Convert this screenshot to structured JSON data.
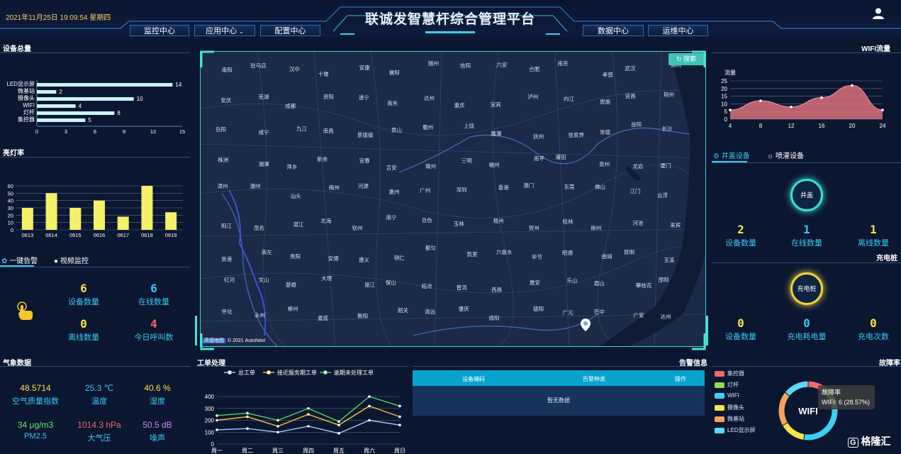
{
  "header": {
    "datetime": "2021年11月25日 19:09:54 星期四",
    "title": "联诚发智慧杆综合管理平台",
    "nav": [
      "监控中心",
      "应用中心",
      "配置中心",
      "数据中心",
      "运维中心"
    ]
  },
  "device_total": {
    "title": "设备总量",
    "chart_data": {
      "type": "bar",
      "orientation": "horizontal",
      "categories": [
        "LED显示屏",
        "微基站",
        "摄像头",
        "WIFI",
        "灯杆",
        "集控器"
      ],
      "values": [
        14,
        2,
        10,
        4,
        8,
        5
      ],
      "xlim": [
        0,
        15
      ],
      "xticks": [
        "0",
        "3",
        "6",
        "9",
        "12",
        "15"
      ]
    }
  },
  "light_rate": {
    "title": "亮灯率",
    "chart_data": {
      "type": "bar",
      "categories": [
        "0613",
        "0614",
        "0615",
        "0616",
        "0617",
        "0618",
        "0619"
      ],
      "values": [
        30,
        50,
        30,
        40,
        18,
        60,
        24
      ],
      "ylim": [
        0,
        60
      ],
      "yticks": [
        "0",
        "10",
        "20",
        "30",
        "40",
        "50",
        "60"
      ]
    }
  },
  "alarm_tabs": {
    "tab1": "一键告警",
    "tab2": "视频监控"
  },
  "alarm_stats": [
    {
      "value": "6",
      "label": "设备数量"
    },
    {
      "value": "6",
      "label": "在线数量"
    },
    {
      "value": "0",
      "label": "离线数量"
    },
    {
      "value": "4",
      "label": "今日呼叫数"
    }
  ],
  "weather": {
    "title": "气象数据",
    "items": [
      {
        "value": "48.5714",
        "label": "空气质量指数",
        "color": "#f7e24a"
      },
      {
        "value": "25.3 ℃",
        "label": "温度",
        "color": "#36c9f5"
      },
      {
        "value": "40.6 %",
        "label": "湿度",
        "color": "#f7e24a"
      },
      {
        "value": "34 μg/m3",
        "label": "PM2.5",
        "color": "#6ee36e"
      },
      {
        "value": "1014.3 hPa",
        "label": "大气压",
        "color": "#f06a6a"
      },
      {
        "value": "50.5 dB",
        "label": "噪声",
        "color": "#c98cf0"
      }
    ]
  },
  "map": {
    "search_label": "搜索",
    "attribution": "© 2021 AutoNavi",
    "logo_text": "高德地图",
    "cities": [
      "南阳",
      "驻马店",
      "汉中",
      "十堰",
      "安康",
      "襄阳",
      "随州",
      "信阳",
      "六安",
      "合肥",
      "南京",
      "孝感",
      "武汉",
      "黄冈",
      "安庆",
      "芜湖",
      "成都",
      "资阳",
      "遂宁",
      "南充",
      "达州",
      "重庆",
      "宜宾",
      "泸州",
      "内江",
      "恩施",
      "宜昌",
      "荆州",
      "岳阳",
      "咸宁",
      "九江",
      "南昌",
      "景德镇",
      "黄山",
      "衢州",
      "上饶",
      "鹰潭",
      "抚州",
      "张家界",
      "常德",
      "益阳",
      "长沙",
      "株洲",
      "湘潭",
      "萍乡",
      "新余",
      "宜春",
      "吉安",
      "赣州",
      "三明",
      "福州",
      "南平",
      "莆田",
      "泉州",
      "龙岩",
      "厦门",
      "漳州",
      "潮州",
      "汕头",
      "梅州",
      "河源",
      "惠州",
      "广州",
      "深圳",
      "香港",
      "澳门",
      "东莞",
      "佛山",
      "江门",
      "云浮",
      "阳江",
      "茂名",
      "湛江",
      "北海",
      "钦州",
      "南宁",
      "百色",
      "玉林",
      "梧州",
      "贺州",
      "桂林",
      "柳州",
      "河池",
      "来宾",
      "贵港",
      "崇左",
      "贵阳",
      "安顺",
      "遵义",
      "铜仁",
      "都匀",
      "凯里",
      "六盘水",
      "毕节",
      "昭通",
      "曲靖",
      "昆明",
      "玉溪",
      "红河",
      "文山",
      "楚雄",
      "大理",
      "丽江",
      "保山",
      "临沧",
      "普洱",
      "西昌",
      "雅安",
      "乐山",
      "眉山",
      "攀枝花",
      "邵阳",
      "怀化",
      "永州",
      "郴州",
      "娄底",
      "衡阳",
      "韶关",
      "清远",
      "肇庆",
      "绵阳",
      "德阳",
      "广元",
      "巴中",
      "广安",
      "达州"
    ]
  },
  "work_orders": {
    "title": "工单处理",
    "chart_data": {
      "type": "line",
      "categories": [
        "周一",
        "周二",
        "周三",
        "周四",
        "周五",
        "周六",
        "周日"
      ],
      "series": [
        {
          "name": "总工单",
          "values": [
            120,
            130,
            100,
            150,
            90,
            200,
            160
          ],
          "color": "#a8cfff"
        },
        {
          "name": "接近服务期工单",
          "values": [
            200,
            230,
            150,
            250,
            160,
            320,
            230
          ],
          "color": "#f5c730"
        },
        {
          "name": "逾期未处理工单",
          "values": [
            240,
            260,
            200,
            300,
            190,
            400,
            320
          ],
          "color": "#4dd666"
        }
      ],
      "ylim": [
        0,
        400
      ],
      "yticks": [
        "0",
        "100",
        "200",
        "300",
        "400"
      ]
    }
  },
  "alarm_info": {
    "title": "告警信息",
    "columns": [
      "设备编码",
      "告警种类",
      "操作"
    ],
    "empty_text": "暂无数据"
  },
  "wifi_flow": {
    "title": "WIFI流量",
    "ylabel": "流量",
    "chart_data": {
      "type": "area",
      "x": [
        4,
        8,
        12,
        16,
        20,
        24
      ],
      "values": [
        6,
        12,
        8,
        14,
        22,
        6
      ],
      "ylim": [
        0,
        25
      ],
      "yticks": [
        "0",
        "5",
        "10",
        "15",
        "20",
        "25"
      ],
      "xticks": [
        "4",
        "8",
        "12",
        "16",
        "20",
        "24"
      ]
    }
  },
  "manhole": {
    "tab1": "井盖设备",
    "tab2": "喷灌设备",
    "ring_label": "井盖",
    "stats": [
      {
        "value": "2",
        "label": "设备数量"
      },
      {
        "value": "1",
        "label": "在线数量"
      },
      {
        "value": "1",
        "label": "离线数量"
      }
    ]
  },
  "charging": {
    "title": "充电桩",
    "ring_label": "充电桩",
    "stats": [
      {
        "value": "0",
        "label": "设备数量"
      },
      {
        "value": "0",
        "label": "充电耗电量"
      },
      {
        "value": "0",
        "label": "充电次数"
      }
    ]
  },
  "fault_rate": {
    "title": "故障率",
    "center_label": "WIFI",
    "tooltip_title": "故障率",
    "tooltip_value": "WIFI: 6 (28.57%)",
    "chart_data": {
      "type": "pie",
      "categories": [
        "集控器",
        "灯杆",
        "WIFI",
        "摄像头",
        "微基站",
        "LED显示屏"
      ],
      "values": [
        2,
        3,
        6,
        3,
        4,
        3
      ],
      "colors": [
        "#f06a6a",
        "#8ee04a",
        "#3ccff0",
        "#f7e24a",
        "#f5a35c",
        "#5fd8f5"
      ]
    }
  },
  "watermark": "格隆汇"
}
